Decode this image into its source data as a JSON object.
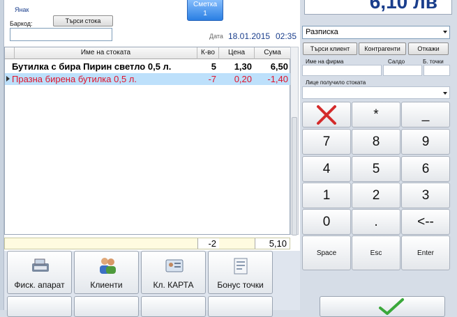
{
  "header": {
    "operator": "Янак",
    "barcode_label": "Баркод:",
    "search_button": "Търси стока",
    "bill_button_line1": "Сметка",
    "bill_button_line2": "1",
    "date_label": "Дата",
    "date": "18.01.2015",
    "time": "02:35"
  },
  "grid": {
    "columns": [
      "Име на стоката",
      "К-во",
      "Цена",
      "Сума"
    ],
    "rows": [
      {
        "name": "Бутилка с бира Пирин светло 0,5 л.",
        "qty": "5",
        "price": "1,30",
        "sum": "6,50"
      },
      {
        "name": "Празна бирена бутилка 0,5 л.",
        "qty": "-7",
        "price": "0,20",
        "sum": "-1,40"
      }
    ],
    "totals": {
      "qty": "-2",
      "sum": "5,10"
    }
  },
  "actions": [
    "Фиск. апарат",
    "Клиенти",
    "Кл. КАРТА",
    "Бонус точки"
  ],
  "right": {
    "total": "6,10 лв",
    "payment_type": "Разписка",
    "client_buttons": [
      "Търси клиент",
      "Контрагенти",
      "Откажи"
    ],
    "field_labels": [
      "Име на фирма",
      "Салдо",
      "Б. точки"
    ],
    "receiver_label": "Лице получило стоката",
    "keypad": [
      "*",
      "_",
      "7",
      "8",
      "9",
      "4",
      "5",
      "6",
      "1",
      "2",
      "3",
      "0",
      ".",
      "<--",
      "Space",
      "Esc",
      "Enter"
    ]
  },
  "colors": {
    "accent": "#1a3e8c",
    "selected_row": "#bde0fb",
    "negative_text": "#e0132b",
    "cancel_x": "#d42b2b"
  }
}
